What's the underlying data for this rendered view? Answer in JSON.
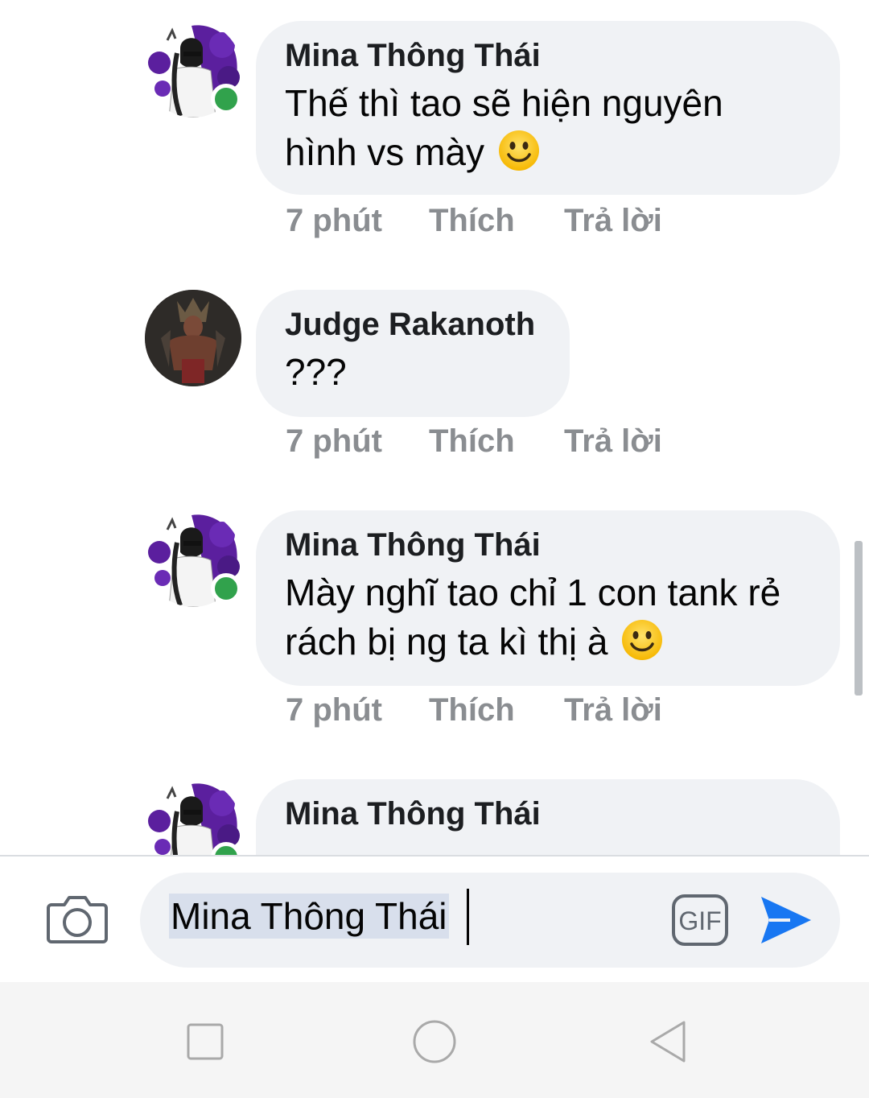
{
  "comments": [
    {
      "author": "Mina Thông Thái",
      "line1": "Thế thì tao sẽ hiện nguyên",
      "line2": "hình vs mày",
      "time": "7 phút",
      "like": "Thích",
      "reply": "Trả lời",
      "online": true
    },
    {
      "author": "Judge Rakanoth",
      "line1": "???",
      "time": "7 phút",
      "like": "Thích",
      "reply": "Trả lời",
      "online": false
    },
    {
      "author": "Mina Thông Thái",
      "line1": "Mày nghĩ tao chỉ 1 con tank rẻ",
      "line2": "rách bị ng ta kì thị à",
      "time": "7 phút",
      "like": "Thích",
      "reply": "Trả lời",
      "online": true
    },
    {
      "author": "Mina Thông Thái",
      "online": true
    }
  ],
  "composer": {
    "input_value": "Mina Thông Thái",
    "gif_label": "GIF"
  },
  "colors": {
    "bubble": "#f0f2f5",
    "online": "#31a24c",
    "send": "#1877f2",
    "meta_text": "#8a8d91"
  },
  "icons": [
    "camera-icon",
    "gif-icon",
    "send-icon",
    "recents-icon",
    "home-icon",
    "back-icon",
    "smile-emoji"
  ]
}
